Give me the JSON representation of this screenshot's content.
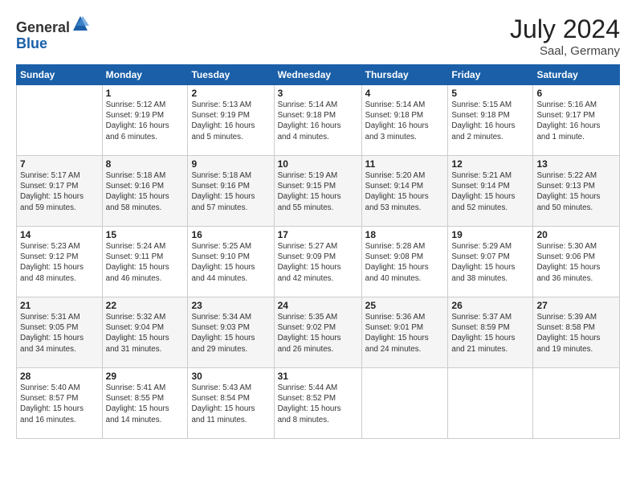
{
  "logo": {
    "general": "General",
    "blue": "Blue"
  },
  "title": "July 2024",
  "location": "Saal, Germany",
  "days_of_week": [
    "Sunday",
    "Monday",
    "Tuesday",
    "Wednesday",
    "Thursday",
    "Friday",
    "Saturday"
  ],
  "weeks": [
    [
      {
        "day": "",
        "content": ""
      },
      {
        "day": "1",
        "content": "Sunrise: 5:12 AM\nSunset: 9:19 PM\nDaylight: 16 hours\nand 6 minutes."
      },
      {
        "day": "2",
        "content": "Sunrise: 5:13 AM\nSunset: 9:19 PM\nDaylight: 16 hours\nand 5 minutes."
      },
      {
        "day": "3",
        "content": "Sunrise: 5:14 AM\nSunset: 9:18 PM\nDaylight: 16 hours\nand 4 minutes."
      },
      {
        "day": "4",
        "content": "Sunrise: 5:14 AM\nSunset: 9:18 PM\nDaylight: 16 hours\nand 3 minutes."
      },
      {
        "day": "5",
        "content": "Sunrise: 5:15 AM\nSunset: 9:18 PM\nDaylight: 16 hours\nand 2 minutes."
      },
      {
        "day": "6",
        "content": "Sunrise: 5:16 AM\nSunset: 9:17 PM\nDaylight: 16 hours\nand 1 minute."
      }
    ],
    [
      {
        "day": "7",
        "content": "Sunrise: 5:17 AM\nSunset: 9:17 PM\nDaylight: 15 hours\nand 59 minutes."
      },
      {
        "day": "8",
        "content": "Sunrise: 5:18 AM\nSunset: 9:16 PM\nDaylight: 15 hours\nand 58 minutes."
      },
      {
        "day": "9",
        "content": "Sunrise: 5:18 AM\nSunset: 9:16 PM\nDaylight: 15 hours\nand 57 minutes."
      },
      {
        "day": "10",
        "content": "Sunrise: 5:19 AM\nSunset: 9:15 PM\nDaylight: 15 hours\nand 55 minutes."
      },
      {
        "day": "11",
        "content": "Sunrise: 5:20 AM\nSunset: 9:14 PM\nDaylight: 15 hours\nand 53 minutes."
      },
      {
        "day": "12",
        "content": "Sunrise: 5:21 AM\nSunset: 9:14 PM\nDaylight: 15 hours\nand 52 minutes."
      },
      {
        "day": "13",
        "content": "Sunrise: 5:22 AM\nSunset: 9:13 PM\nDaylight: 15 hours\nand 50 minutes."
      }
    ],
    [
      {
        "day": "14",
        "content": "Sunrise: 5:23 AM\nSunset: 9:12 PM\nDaylight: 15 hours\nand 48 minutes."
      },
      {
        "day": "15",
        "content": "Sunrise: 5:24 AM\nSunset: 9:11 PM\nDaylight: 15 hours\nand 46 minutes."
      },
      {
        "day": "16",
        "content": "Sunrise: 5:25 AM\nSunset: 9:10 PM\nDaylight: 15 hours\nand 44 minutes."
      },
      {
        "day": "17",
        "content": "Sunrise: 5:27 AM\nSunset: 9:09 PM\nDaylight: 15 hours\nand 42 minutes."
      },
      {
        "day": "18",
        "content": "Sunrise: 5:28 AM\nSunset: 9:08 PM\nDaylight: 15 hours\nand 40 minutes."
      },
      {
        "day": "19",
        "content": "Sunrise: 5:29 AM\nSunset: 9:07 PM\nDaylight: 15 hours\nand 38 minutes."
      },
      {
        "day": "20",
        "content": "Sunrise: 5:30 AM\nSunset: 9:06 PM\nDaylight: 15 hours\nand 36 minutes."
      }
    ],
    [
      {
        "day": "21",
        "content": "Sunrise: 5:31 AM\nSunset: 9:05 PM\nDaylight: 15 hours\nand 34 minutes."
      },
      {
        "day": "22",
        "content": "Sunrise: 5:32 AM\nSunset: 9:04 PM\nDaylight: 15 hours\nand 31 minutes."
      },
      {
        "day": "23",
        "content": "Sunrise: 5:34 AM\nSunset: 9:03 PM\nDaylight: 15 hours\nand 29 minutes."
      },
      {
        "day": "24",
        "content": "Sunrise: 5:35 AM\nSunset: 9:02 PM\nDaylight: 15 hours\nand 26 minutes."
      },
      {
        "day": "25",
        "content": "Sunrise: 5:36 AM\nSunset: 9:01 PM\nDaylight: 15 hours\nand 24 minutes."
      },
      {
        "day": "26",
        "content": "Sunrise: 5:37 AM\nSunset: 8:59 PM\nDaylight: 15 hours\nand 21 minutes."
      },
      {
        "day": "27",
        "content": "Sunrise: 5:39 AM\nSunset: 8:58 PM\nDaylight: 15 hours\nand 19 minutes."
      }
    ],
    [
      {
        "day": "28",
        "content": "Sunrise: 5:40 AM\nSunset: 8:57 PM\nDaylight: 15 hours\nand 16 minutes."
      },
      {
        "day": "29",
        "content": "Sunrise: 5:41 AM\nSunset: 8:55 PM\nDaylight: 15 hours\nand 14 minutes."
      },
      {
        "day": "30",
        "content": "Sunrise: 5:43 AM\nSunset: 8:54 PM\nDaylight: 15 hours\nand 11 minutes."
      },
      {
        "day": "31",
        "content": "Sunrise: 5:44 AM\nSunset: 8:52 PM\nDaylight: 15 hours\nand 8 minutes."
      },
      {
        "day": "",
        "content": ""
      },
      {
        "day": "",
        "content": ""
      },
      {
        "day": "",
        "content": ""
      }
    ]
  ]
}
